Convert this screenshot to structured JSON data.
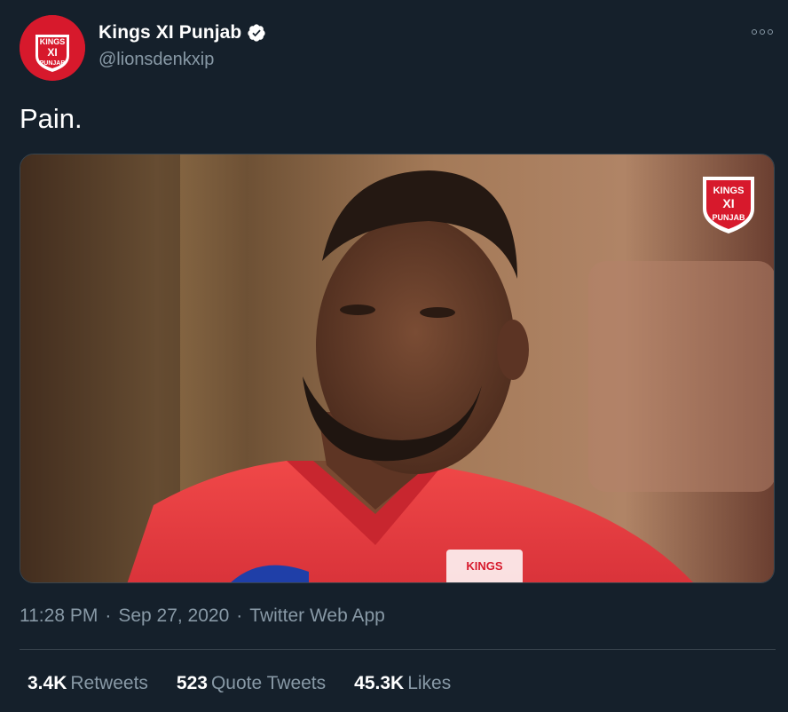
{
  "author": {
    "display_name": "Kings XI Punjab",
    "handle": "@lionsdenkxip",
    "verified": true,
    "avatar_logo": {
      "line1": "KINGS",
      "line2": "XI",
      "line3": "PUNJAB"
    }
  },
  "more_icon": "more-horizontal-icon",
  "tweet": {
    "text": "Pain."
  },
  "media": {
    "logo_watermark": {
      "line1": "KINGS",
      "line2": "XI",
      "line3": "PUNJAB"
    },
    "jersey_badge": "KINGS"
  },
  "meta": {
    "time": "11:28 PM",
    "separator1": "·",
    "date": "Sep 27, 2020",
    "separator2": "·",
    "source": "Twitter Web App"
  },
  "stats": {
    "retweets_count": "3.4K",
    "retweets_label": "Retweets",
    "quotes_count": "523",
    "quotes_label": "Quote Tweets",
    "likes_count": "45.3K",
    "likes_label": "Likes"
  },
  "colors": {
    "background": "#15202b",
    "secondary_text": "#8899a6",
    "brand_red": "#d7192c",
    "border": "#38444d"
  }
}
